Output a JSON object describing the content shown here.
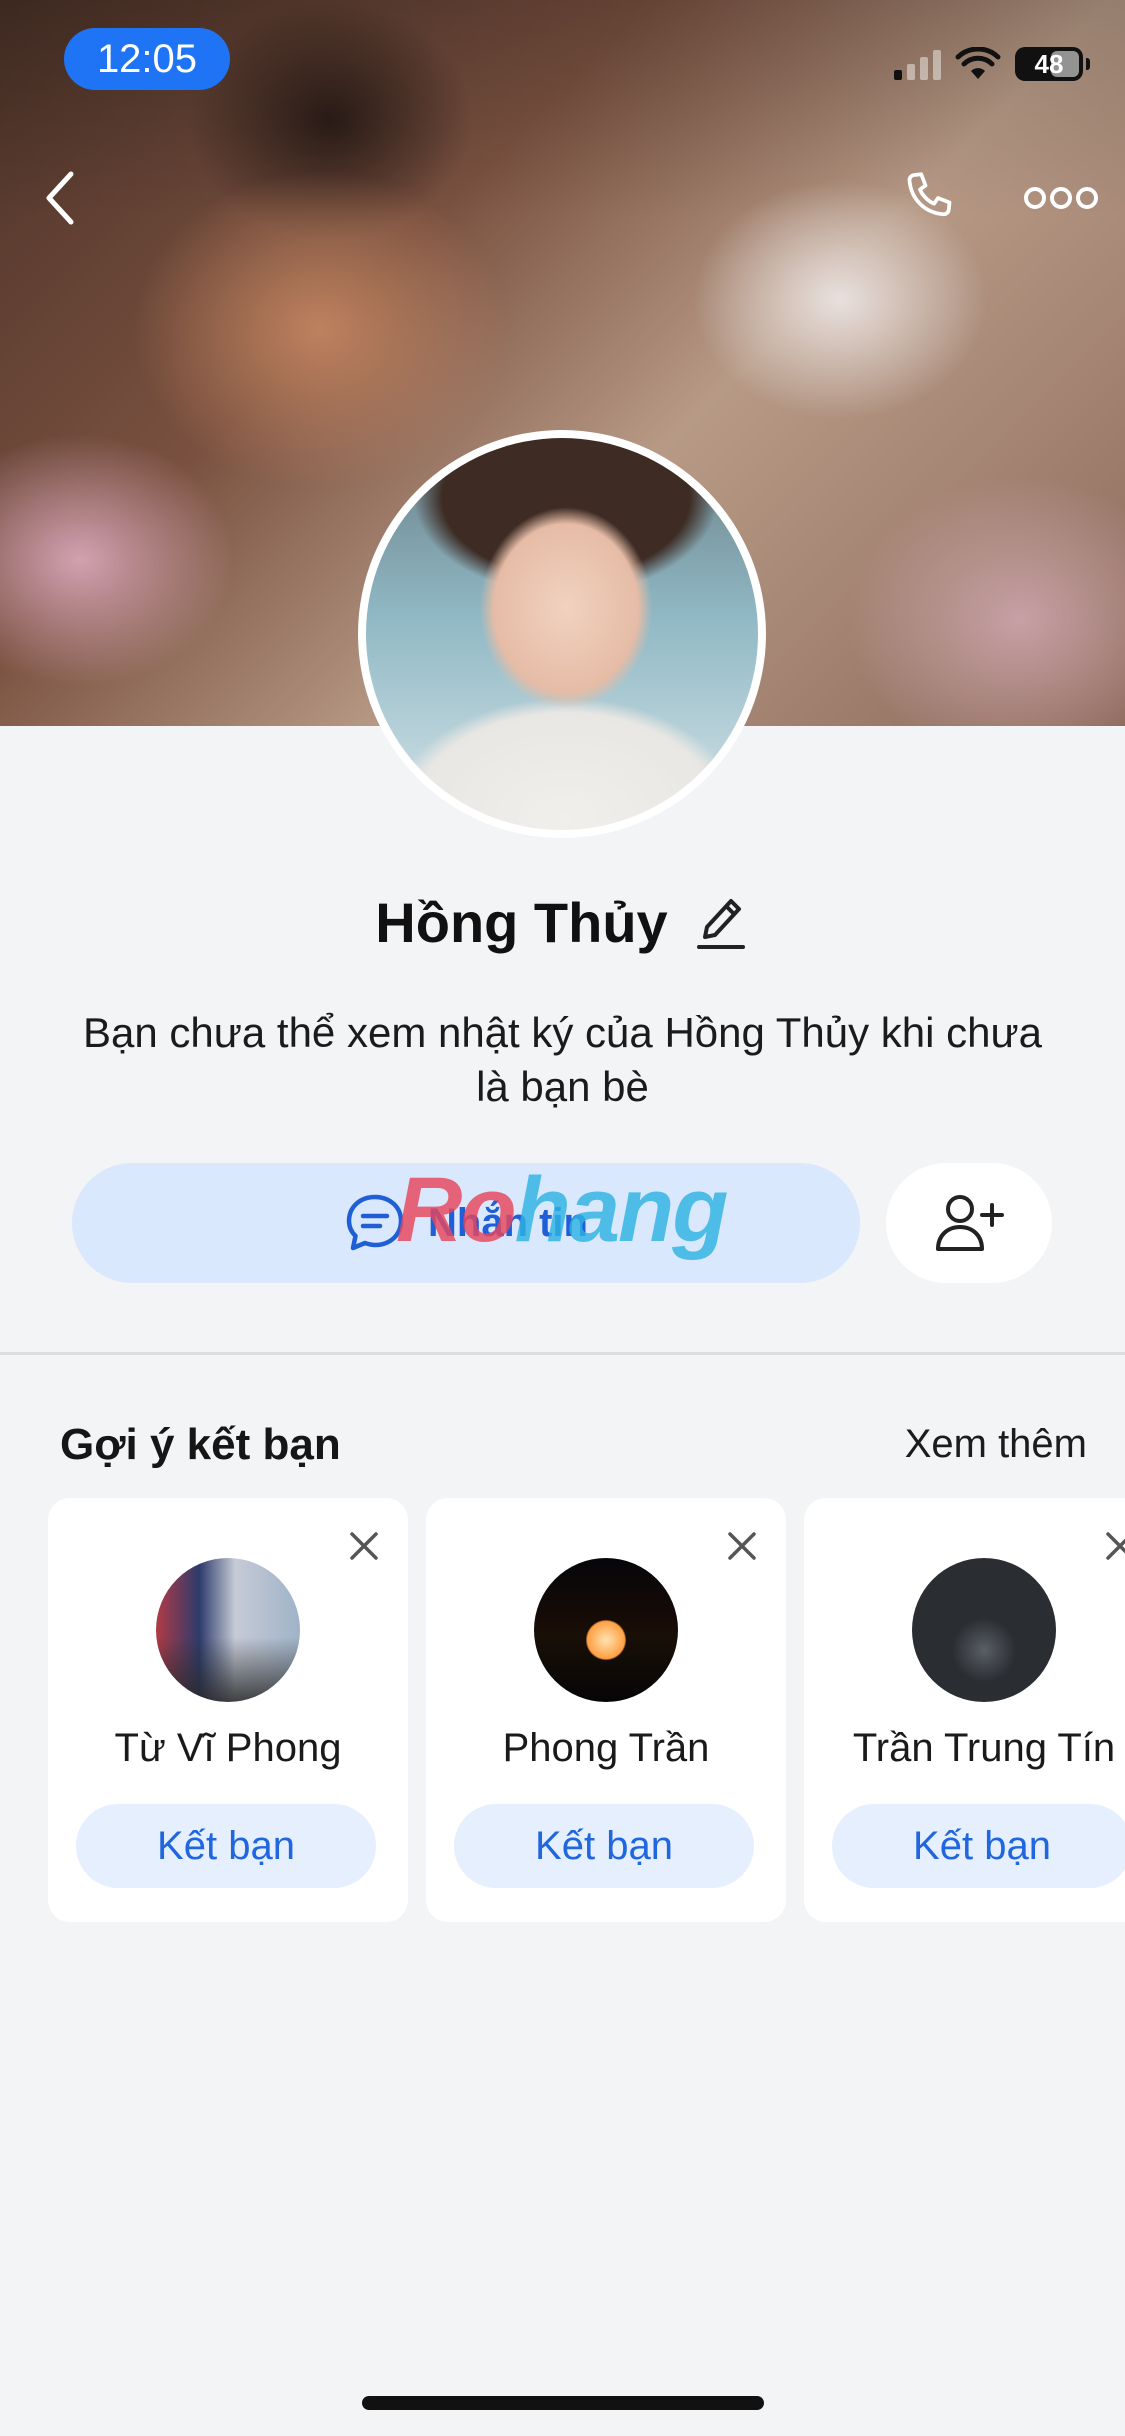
{
  "status_bar": {
    "time": "12:05",
    "battery": "48"
  },
  "profile": {
    "name": "Hồng Thủy",
    "notice": "Bạn chưa thể xem nhật ký của Hồng Thủy khi chưa là bạn bè",
    "message_label": "Nhắn tin"
  },
  "watermark": {
    "part1": "Ro",
    "part2": "hang"
  },
  "suggestions": {
    "title": "Gợi ý kết bạn",
    "see_more": "Xem thêm",
    "items": [
      {
        "name": "Từ Vĩ Phong",
        "action": "Kết bạn"
      },
      {
        "name": "Phong Trần",
        "action": "Kết bạn"
      },
      {
        "name": "Trần Trung Tín",
        "action": "Kết bạn"
      }
    ]
  },
  "colors": {
    "accent": "#1f74f6",
    "message_bg": "#d9e8fc",
    "add_friend_bg": "#e5effd"
  }
}
